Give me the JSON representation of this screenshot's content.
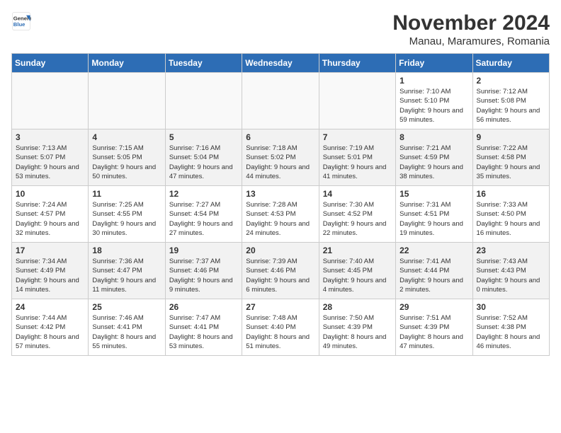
{
  "logo": {
    "line1": "General",
    "line2": "Blue"
  },
  "title": "November 2024",
  "location": "Manau, Maramures, Romania",
  "days_of_week": [
    "Sunday",
    "Monday",
    "Tuesday",
    "Wednesday",
    "Thursday",
    "Friday",
    "Saturday"
  ],
  "weeks": [
    [
      {
        "day": "",
        "info": ""
      },
      {
        "day": "",
        "info": ""
      },
      {
        "day": "",
        "info": ""
      },
      {
        "day": "",
        "info": ""
      },
      {
        "day": "",
        "info": ""
      },
      {
        "day": "1",
        "info": "Sunrise: 7:10 AM\nSunset: 5:10 PM\nDaylight: 9 hours and 59 minutes."
      },
      {
        "day": "2",
        "info": "Sunrise: 7:12 AM\nSunset: 5:08 PM\nDaylight: 9 hours and 56 minutes."
      }
    ],
    [
      {
        "day": "3",
        "info": "Sunrise: 7:13 AM\nSunset: 5:07 PM\nDaylight: 9 hours and 53 minutes."
      },
      {
        "day": "4",
        "info": "Sunrise: 7:15 AM\nSunset: 5:05 PM\nDaylight: 9 hours and 50 minutes."
      },
      {
        "day": "5",
        "info": "Sunrise: 7:16 AM\nSunset: 5:04 PM\nDaylight: 9 hours and 47 minutes."
      },
      {
        "day": "6",
        "info": "Sunrise: 7:18 AM\nSunset: 5:02 PM\nDaylight: 9 hours and 44 minutes."
      },
      {
        "day": "7",
        "info": "Sunrise: 7:19 AM\nSunset: 5:01 PM\nDaylight: 9 hours and 41 minutes."
      },
      {
        "day": "8",
        "info": "Sunrise: 7:21 AM\nSunset: 4:59 PM\nDaylight: 9 hours and 38 minutes."
      },
      {
        "day": "9",
        "info": "Sunrise: 7:22 AM\nSunset: 4:58 PM\nDaylight: 9 hours and 35 minutes."
      }
    ],
    [
      {
        "day": "10",
        "info": "Sunrise: 7:24 AM\nSunset: 4:57 PM\nDaylight: 9 hours and 32 minutes."
      },
      {
        "day": "11",
        "info": "Sunrise: 7:25 AM\nSunset: 4:55 PM\nDaylight: 9 hours and 30 minutes."
      },
      {
        "day": "12",
        "info": "Sunrise: 7:27 AM\nSunset: 4:54 PM\nDaylight: 9 hours and 27 minutes."
      },
      {
        "day": "13",
        "info": "Sunrise: 7:28 AM\nSunset: 4:53 PM\nDaylight: 9 hours and 24 minutes."
      },
      {
        "day": "14",
        "info": "Sunrise: 7:30 AM\nSunset: 4:52 PM\nDaylight: 9 hours and 22 minutes."
      },
      {
        "day": "15",
        "info": "Sunrise: 7:31 AM\nSunset: 4:51 PM\nDaylight: 9 hours and 19 minutes."
      },
      {
        "day": "16",
        "info": "Sunrise: 7:33 AM\nSunset: 4:50 PM\nDaylight: 9 hours and 16 minutes."
      }
    ],
    [
      {
        "day": "17",
        "info": "Sunrise: 7:34 AM\nSunset: 4:49 PM\nDaylight: 9 hours and 14 minutes."
      },
      {
        "day": "18",
        "info": "Sunrise: 7:36 AM\nSunset: 4:47 PM\nDaylight: 9 hours and 11 minutes."
      },
      {
        "day": "19",
        "info": "Sunrise: 7:37 AM\nSunset: 4:46 PM\nDaylight: 9 hours and 9 minutes."
      },
      {
        "day": "20",
        "info": "Sunrise: 7:39 AM\nSunset: 4:46 PM\nDaylight: 9 hours and 6 minutes."
      },
      {
        "day": "21",
        "info": "Sunrise: 7:40 AM\nSunset: 4:45 PM\nDaylight: 9 hours and 4 minutes."
      },
      {
        "day": "22",
        "info": "Sunrise: 7:41 AM\nSunset: 4:44 PM\nDaylight: 9 hours and 2 minutes."
      },
      {
        "day": "23",
        "info": "Sunrise: 7:43 AM\nSunset: 4:43 PM\nDaylight: 9 hours and 0 minutes."
      }
    ],
    [
      {
        "day": "24",
        "info": "Sunrise: 7:44 AM\nSunset: 4:42 PM\nDaylight: 8 hours and 57 minutes."
      },
      {
        "day": "25",
        "info": "Sunrise: 7:46 AM\nSunset: 4:41 PM\nDaylight: 8 hours and 55 minutes."
      },
      {
        "day": "26",
        "info": "Sunrise: 7:47 AM\nSunset: 4:41 PM\nDaylight: 8 hours and 53 minutes."
      },
      {
        "day": "27",
        "info": "Sunrise: 7:48 AM\nSunset: 4:40 PM\nDaylight: 8 hours and 51 minutes."
      },
      {
        "day": "28",
        "info": "Sunrise: 7:50 AM\nSunset: 4:39 PM\nDaylight: 8 hours and 49 minutes."
      },
      {
        "day": "29",
        "info": "Sunrise: 7:51 AM\nSunset: 4:39 PM\nDaylight: 8 hours and 47 minutes."
      },
      {
        "day": "30",
        "info": "Sunrise: 7:52 AM\nSunset: 4:38 PM\nDaylight: 8 hours and 46 minutes."
      }
    ]
  ]
}
